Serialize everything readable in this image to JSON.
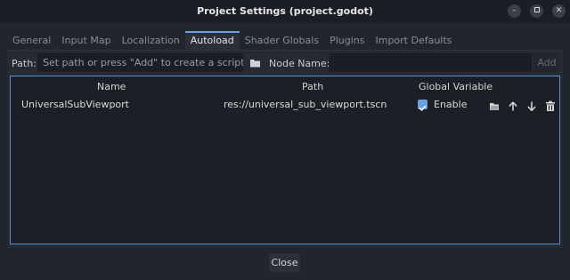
{
  "window": {
    "title": "Project Settings (project.godot)"
  },
  "tabs": [
    {
      "label": "General"
    },
    {
      "label": "Input Map"
    },
    {
      "label": "Localization"
    },
    {
      "label": "Autoload"
    },
    {
      "label": "Shader Globals"
    },
    {
      "label": "Plugins"
    },
    {
      "label": "Import Defaults"
    }
  ],
  "active_tab": "Autoload",
  "path_bar": {
    "path_label": "Path:",
    "path_placeholder": "Set path or press \"Add\" to create a script.",
    "node_name_label": "Node Name:",
    "node_name_value": "",
    "add_label": "Add"
  },
  "table": {
    "headers": {
      "name": "Name",
      "path": "Path",
      "global": "Global Variable"
    },
    "rows": [
      {
        "name": "UniversalSubViewport",
        "path": "res://universal_sub_viewport.tscn",
        "enabled": true,
        "enable_label": "Enable"
      }
    ]
  },
  "footer": {
    "close_label": "Close"
  },
  "colors": {
    "accent": "#6d9fde",
    "background": "#21252d",
    "panel": "#262a32",
    "field": "#1b1e24"
  },
  "icons": [
    "minimize-icon",
    "maximize-icon",
    "close-icon",
    "folder-icon",
    "folder-open-icon",
    "arrow-up-icon",
    "arrow-down-icon",
    "trash-icon",
    "checkmark-icon"
  ]
}
